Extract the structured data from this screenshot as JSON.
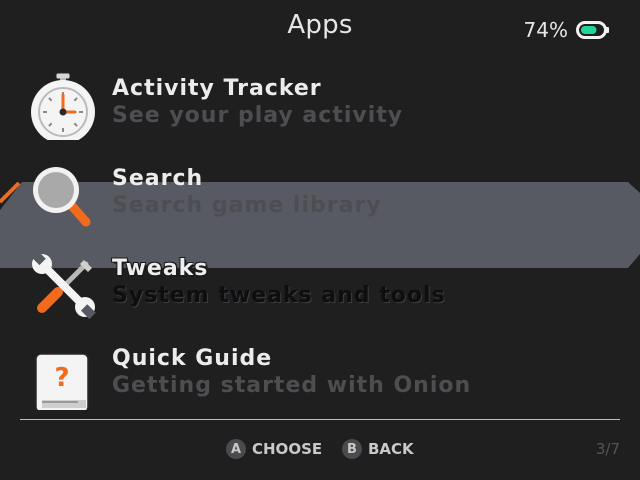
{
  "header": {
    "title": "Apps",
    "battery_text": "74%",
    "battery_level": 0.74,
    "battery_color": "#1fd49a"
  },
  "list": {
    "items": [
      {
        "title": "Activity Tracker",
        "subtitle": "See your play activity",
        "icon": "stopwatch-icon"
      },
      {
        "title": "Search",
        "subtitle": "Search game library",
        "icon": "magnifier-icon"
      },
      {
        "title": "Tweaks",
        "subtitle": "System tweaks and tools",
        "icon": "wrench-screwdriver-icon",
        "selected": true
      },
      {
        "title": "Quick Guide",
        "subtitle": "Getting started with Onion",
        "icon": "guide-book-icon"
      }
    ],
    "accent_color": "#f26a1b",
    "selection_color": "#575a62"
  },
  "footer": {
    "a_glyph": "A",
    "a_label": "CHOOSE",
    "b_glyph": "B",
    "b_label": "BACK",
    "page_indicator": "3/7"
  }
}
